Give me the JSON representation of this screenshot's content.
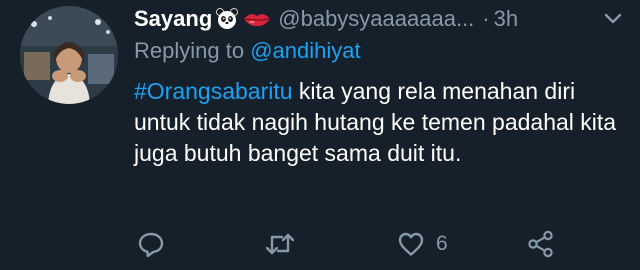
{
  "tweet": {
    "display_name": "Sayang",
    "name_emojis": [
      "panda-face-icon",
      "lips-icon"
    ],
    "handle": "@babysyaaaaaaa...",
    "separator": "·",
    "timestamp": "3h",
    "reply_prefix": "Replying to",
    "reply_mention": "@andihiyat",
    "hashtag": "#Orangsabaritu",
    "body": " kita yang rela menahan diri untuk tidak nagih hutang ke temen padahal kita juga butuh banget sama duit itu.",
    "actions": {
      "reply_icon": "reply-icon",
      "retweet_icon": "retweet-icon",
      "like_icon": "heart-icon",
      "like_count": "6",
      "share_icon": "share-icon"
    }
  },
  "colors": {
    "background": "#15202b",
    "text": "#ffffff",
    "secondary": "#8899a6",
    "accent": "#1da1f2"
  }
}
